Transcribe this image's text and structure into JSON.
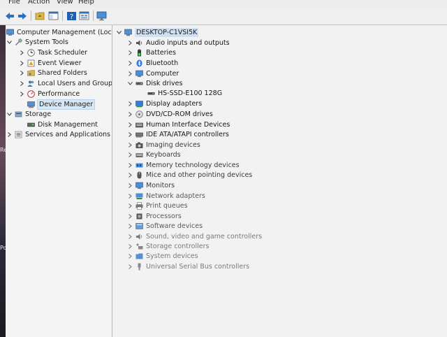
{
  "menubar": {
    "items": [
      "File",
      "Action",
      "View",
      "Help"
    ]
  },
  "toolbar": {
    "buttons": [
      "back-arrow-icon",
      "forward-arrow-icon",
      "up-folder-icon",
      "show-console-tree-icon",
      "help-icon",
      "properties-icon",
      "monitor-icon"
    ]
  },
  "left_strip": {
    "texts": [
      "Re",
      "Po"
    ]
  },
  "left_tree": {
    "root": "Computer Management (Local",
    "system_tools": "System Tools",
    "task_scheduler": "Task Scheduler",
    "event_viewer": "Event Viewer",
    "shared_folders": "Shared Folders",
    "local_users_groups": "Local Users and Groups",
    "performance": "Performance",
    "device_manager": "Device Manager",
    "storage": "Storage",
    "disk_management": "Disk Management",
    "services_apps": "Services and Applications"
  },
  "device_tree": {
    "computer_name": "DESKTOP-C1VSI5K",
    "categories": [
      "Audio inputs and outputs",
      "Batteries",
      "Bluetooth",
      "Computer",
      "Disk drives",
      "HS-SSD-E100 128G",
      "Display adapters",
      "DVD/CD-ROM drives",
      "Human Interface Devices",
      "IDE ATA/ATAPI controllers",
      "Imaging devices",
      "Keyboards",
      "Memory technology devices",
      "Mice and other pointing devices",
      "Monitors",
      "Network adapters",
      "Print queues",
      "Processors",
      "Software devices",
      "Sound, video and game controllers",
      "Storage controllers",
      "System devices",
      "Universal Serial Bus controllers"
    ]
  },
  "colors": {
    "selection": "#d7e6f5",
    "folder": "#e0b64a",
    "device_blue": "#3a7bd5"
  }
}
